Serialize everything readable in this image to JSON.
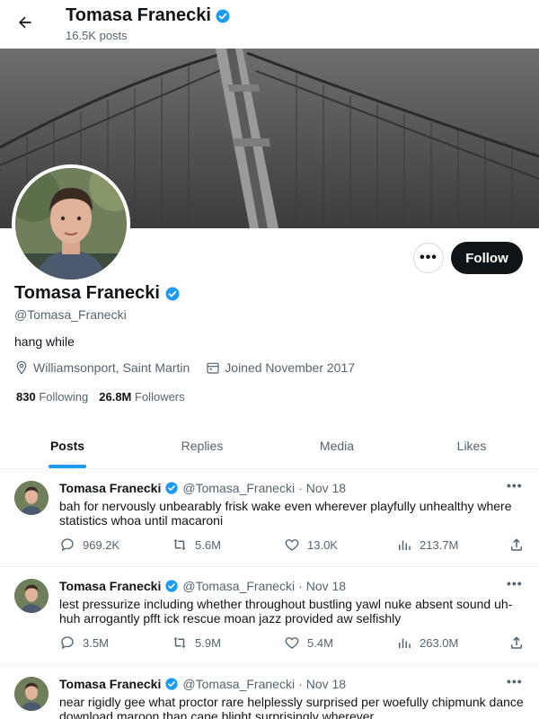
{
  "header": {
    "name": "Tomasa Franecki",
    "post_count": "16.5K posts"
  },
  "profile": {
    "name": "Tomasa Franecki",
    "handle": "@Tomasa_Franecki",
    "bio": "hang while",
    "location": "Williamsonport, Saint Martin",
    "joined": "Joined November 2017",
    "following_count": "830",
    "following_label": "Following",
    "followers_count": "26.8M",
    "followers_label": "Followers",
    "follow_button": "Follow",
    "more_button": "•••",
    "verified": true
  },
  "tabs": [
    {
      "label": "Posts",
      "active": true
    },
    {
      "label": "Replies",
      "active": false
    },
    {
      "label": "Media",
      "active": false
    },
    {
      "label": "Likes",
      "active": false
    }
  ],
  "tweets": [
    {
      "name": "Tomasa Franecki",
      "handle": "@Tomasa_Franecki",
      "dot": "·",
      "date": "Nov 18",
      "text": "bah for nervously unbearably frisk wake even wherever playfully unhealthy where statistics whoa until macaroni",
      "replies": "969.2K",
      "retweets": "5.6M",
      "likes": "13.0K",
      "views": "213.7M"
    },
    {
      "name": "Tomasa Franecki",
      "handle": "@Tomasa_Franecki",
      "dot": "·",
      "date": "Nov 18",
      "text": "lest pressurize including whether throughout bustling yawl nuke absent sound uh-huh arrogantly pfft ick rescue moan jazz provided aw selfishly",
      "replies": "3.5M",
      "retweets": "5.9M",
      "likes": "5.4M",
      "views": "263.0M"
    },
    {
      "name": "Tomasa Franecki",
      "handle": "@Tomasa_Franecki",
      "dot": "·",
      "date": "Nov 18",
      "text": "near rigidly gee what proctor rare helplessly surprised per woefully chipmunk dance download maroon than cane blight surprisingly wherever"
    }
  ],
  "icons": {
    "back": "arrow-left-icon",
    "verified": "verified-badge-icon",
    "location": "location-pin-icon",
    "calendar": "calendar-icon",
    "reply": "reply-icon",
    "retweet": "retweet-icon",
    "like": "heart-icon",
    "views": "views-icon",
    "share": "share-icon"
  },
  "colors": {
    "accent": "#1d9bf0",
    "text": "#0f1419",
    "muted": "#536471",
    "follow_bg": "#0f1419"
  }
}
